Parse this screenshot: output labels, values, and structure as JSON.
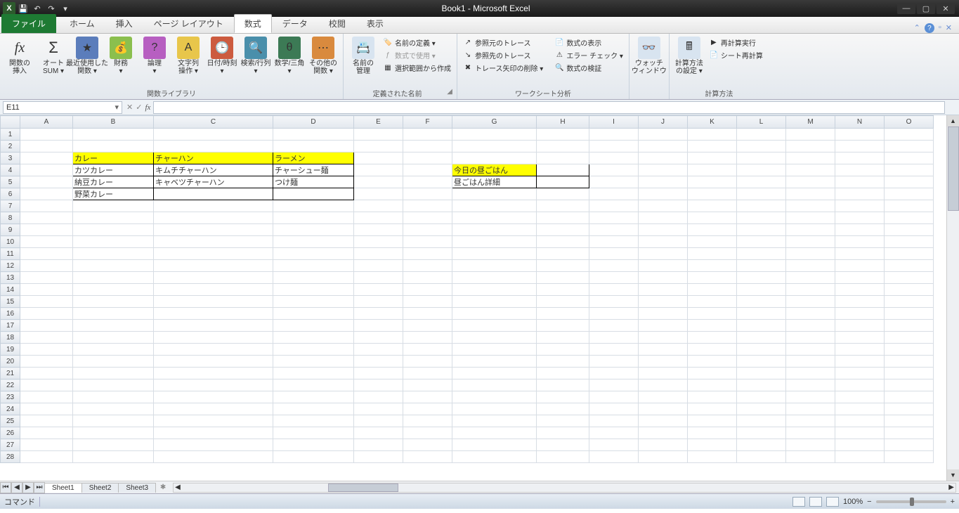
{
  "title": "Book1 - Microsoft Excel",
  "tabs": {
    "file": "ファイル",
    "home": "ホーム",
    "insert": "挿入",
    "layout": "ページ レイアウト",
    "formula": "数式",
    "data": "データ",
    "review": "校閲",
    "view": "表示"
  },
  "groups": {
    "fx_insert": "関数の\n挿入",
    "autosum": "オート\nSUM ▾",
    "recent": "最近使用した\n関数 ▾",
    "finance": "財務\n▾",
    "logic": "論理\n▾",
    "text": "文字列\n操作 ▾",
    "datetime": "日付/時刻\n▾",
    "lookup": "検索/行列\n▾",
    "math": "数学/三角\n▾",
    "other": "その他の\n関数 ▾",
    "lib_label": "関数ライブラリ",
    "name_mgr": "名前の\n管理",
    "def_name": "名前の定義 ▾",
    "use_fml": "数式で使用 ▾",
    "from_sel": "選択範囲から作成",
    "names_label": "定義された名前",
    "trace_prec": "参照元のトレース",
    "trace_dep": "参照先のトレース",
    "remove_arrows": "トレース矢印の削除 ▾",
    "show_fml": "数式の表示",
    "err_check": "エラー チェック ▾",
    "eval_fml": "数式の検証",
    "audit_label": "ワークシート分析",
    "watch": "ウォッチ\nウィンドウ",
    "calc_opt": "計算方法\nの設定 ▾",
    "calc_now": "再計算実行",
    "calc_sheet": "シート再計算",
    "calc_label": "計算方法"
  },
  "namebox": "E11",
  "cols": [
    "A",
    "B",
    "C",
    "D",
    "E",
    "F",
    "G",
    "H",
    "I",
    "J",
    "K",
    "L",
    "M",
    "N",
    "O"
  ],
  "cells": {
    "B3": "カレー",
    "C3": "チャーハン",
    "D3": "ラーメン",
    "B4": "カツカレー",
    "C4": "キムチチャーハン",
    "D4": "チャーシュー麺",
    "B5": "納豆カレー",
    "C5": "キャベツチャーハン",
    "D5": "つけ麺",
    "B6": "野菜カレー",
    "G4": "今日の昼ごはん",
    "G5": "昼ごはん詳細"
  },
  "sheets": {
    "s1": "Sheet1",
    "s2": "Sheet2",
    "s3": "Sheet3"
  },
  "status": {
    "left": "コマンド",
    "zoom": "100%"
  }
}
